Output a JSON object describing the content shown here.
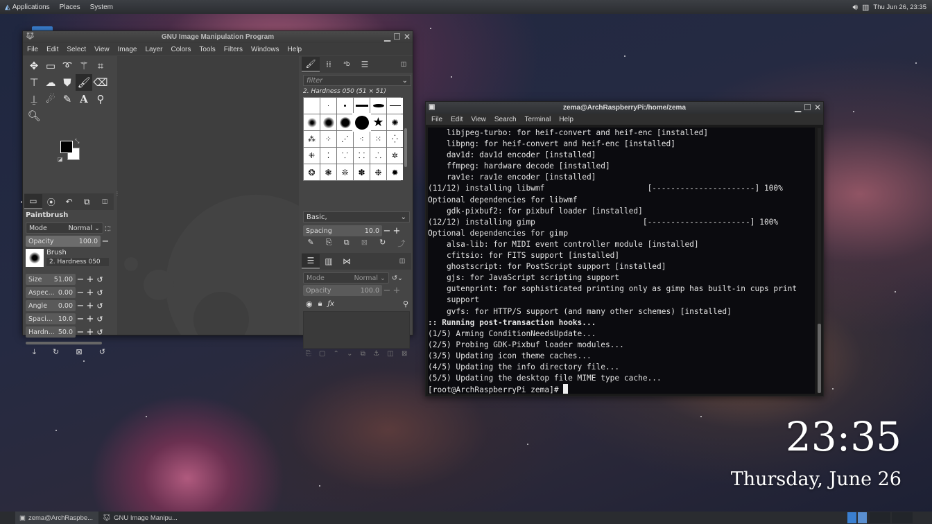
{
  "top_panel": {
    "menus": [
      "Applications",
      "Places",
      "System"
    ],
    "datetime": "Thu Jun 26, 23:35"
  },
  "gimp": {
    "title": "GNU Image Manipulation Program",
    "menu": [
      "File",
      "Edit",
      "Select",
      "View",
      "Image",
      "Layer",
      "Colors",
      "Tools",
      "Filters",
      "Windows",
      "Help"
    ],
    "tool_options": {
      "tool_name": "Paintbrush",
      "mode_label": "Mode",
      "mode_value": "Normal",
      "opacity_label": "Opacity",
      "opacity_value": "100.0",
      "brush_label": "Brush",
      "brush_value": "2. Hardness 050",
      "rows": [
        {
          "label": "Size",
          "value": "51.00"
        },
        {
          "label": "Aspec...",
          "value": "0.00"
        },
        {
          "label": "Angle",
          "value": "0.00"
        },
        {
          "label": "Spaci...",
          "value": "10.0"
        },
        {
          "label": "Hardn...",
          "value": "50.0"
        }
      ]
    },
    "brushes": {
      "filter_placeholder": "filter",
      "current": "2. Hardness 050 (51 × 51)",
      "tag": "Basic,",
      "spacing_label": "Spacing",
      "spacing_value": "10.0"
    },
    "layers": {
      "mode_label": "Mode",
      "mode_value": "Normal",
      "opacity_label": "Opacity",
      "opacity_value": "100.0"
    }
  },
  "terminal": {
    "title": "zema@ArchRaspberryPi:/home/zema",
    "menu": [
      "File",
      "Edit",
      "View",
      "Search",
      "Terminal",
      "Help"
    ],
    "lines": [
      "    libjpeg-turbo: for heif-convert and heif-enc [installed]",
      "    libpng: for heif-convert and heif-enc [installed]",
      "    dav1d: dav1d encoder [installed]",
      "    ffmpeg: hardware decode [installed]",
      "    rav1e: rav1e encoder [installed]",
      "(11/12) installing libwmf                      [----------------------] 100%",
      "Optional dependencies for libwmf",
      "    gdk-pixbuf2: for pixbuf loader [installed]",
      "(12/12) installing gimp                       [----------------------] 100%",
      "Optional dependencies for gimp",
      "    alsa-lib: for MIDI event controller module [installed]",
      "    cfitsio: for FITS support [installed]",
      "    ghostscript: for PostScript support [installed]",
      "    gjs: for JavaScript scripting support",
      "    gutenprint: for sophisticated printing only as gimp has built-in cups print",
      "    support",
      "    gvfs: for HTTP/S support (and many other schemes) [installed]",
      ":: Running post-transaction hooks...",
      "(1/5) Arming ConditionNeedsUpdate...",
      "(2/5) Probing GDK-Pixbuf loader modules...",
      "(3/5) Updating icon theme caches...",
      "(4/5) Updating the info directory file...",
      "(5/5) Updating the desktop file MIME type cache...",
      "[root@ArchRaspberryPi zema]# "
    ]
  },
  "desktop_clock": {
    "time": "23:35",
    "date": "Thursday, June 26"
  },
  "taskbar": {
    "tasks": [
      "zema@ArchRaspbe...",
      "GNU Image Manipu..."
    ]
  }
}
